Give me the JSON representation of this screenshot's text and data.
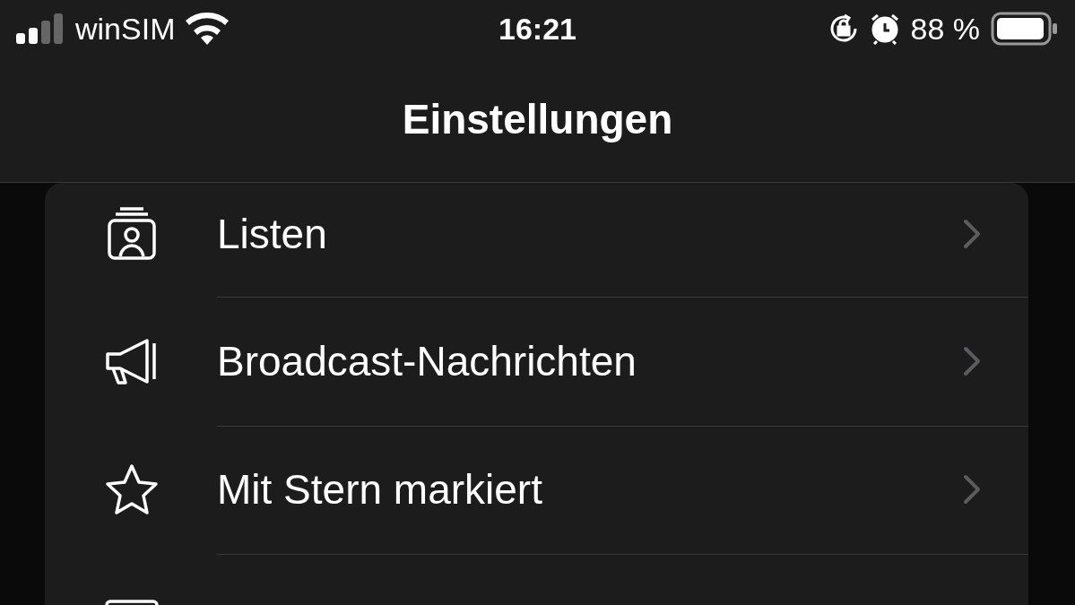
{
  "status_bar": {
    "carrier": "winSIM",
    "time": "16:21",
    "battery": "88 %"
  },
  "nav_bar": {
    "title": "Einstellungen"
  },
  "rows": [
    {
      "kind": "lists",
      "label": "Listen"
    },
    {
      "kind": "broadcast",
      "label": "Broadcast-Nachrichten"
    },
    {
      "kind": "starred",
      "label": "Mit Stern markiert"
    },
    {
      "kind": "devices"
    }
  ]
}
